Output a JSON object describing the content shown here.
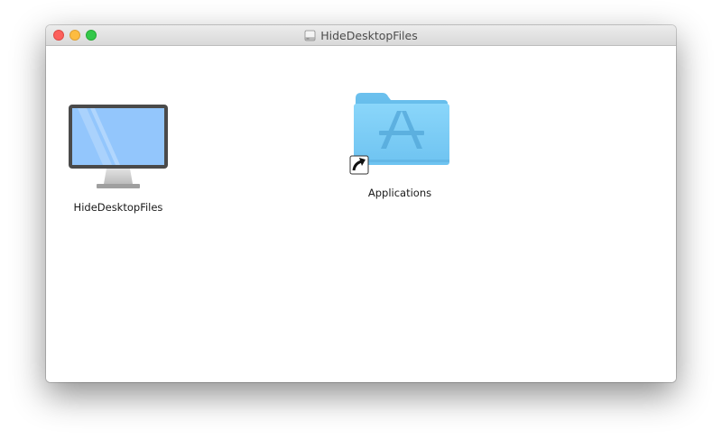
{
  "window": {
    "title": "HideDesktopFiles",
    "title_icon": "disk-icon"
  },
  "desktop": {
    "items": [
      {
        "label": "HideDesktopFiles",
        "icon": "monitor-icon"
      },
      {
        "label": "Applications",
        "icon": "applications-folder-icon",
        "alias": true
      }
    ]
  },
  "colors": {
    "folder_blue": "#7ecff5",
    "screen_blue": "#91c6fc",
    "close": "#fc605c",
    "minimize": "#fdbc40",
    "zoom": "#34c84a"
  }
}
